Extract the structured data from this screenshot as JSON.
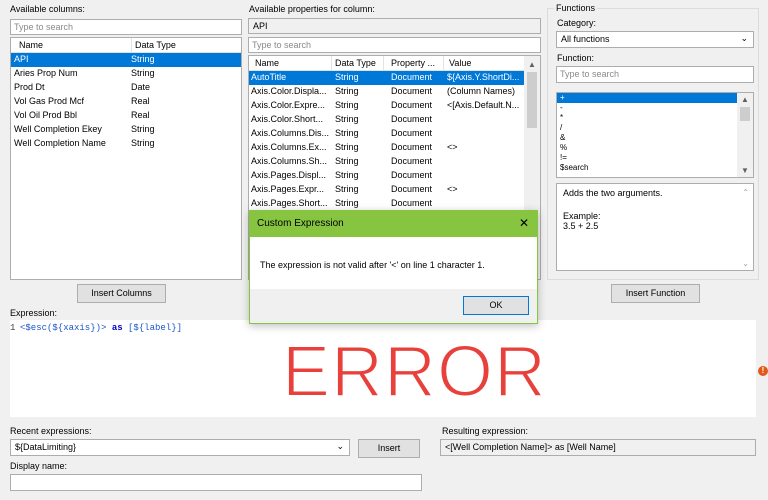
{
  "available_columns": {
    "label": "Available columns:",
    "search_placeholder": "Type to search",
    "headers": {
      "name": "Name",
      "type": "Data Type"
    },
    "rows": [
      {
        "name": "API",
        "type": "String"
      },
      {
        "name": "Aries Prop Num",
        "type": "String"
      },
      {
        "name": "Prod Dt",
        "type": "Date"
      },
      {
        "name": "Vol Gas Prod Mcf",
        "type": "Real"
      },
      {
        "name": "Vol Oil Prod Bbl",
        "type": "Real"
      },
      {
        "name": "Well Completion Ekey",
        "type": "String"
      },
      {
        "name": "Well Completion Name",
        "type": "String"
      }
    ],
    "insert_button": "Insert Columns"
  },
  "properties": {
    "label": "Available properties for column:",
    "column_value": "API",
    "search_placeholder": "Type to search",
    "headers": {
      "name": "Name",
      "type": "Data Type",
      "property": "Property ...",
      "value": "Value"
    },
    "rows": [
      {
        "name": "AutoTitle",
        "type": "String",
        "property": "Document",
        "value": "${Axis.Y.ShortDi..."
      },
      {
        "name": "Axis.Color.Displa...",
        "type": "String",
        "property": "Document",
        "value": "(Column Names)"
      },
      {
        "name": "Axis.Color.Expre...",
        "type": "String",
        "property": "Document",
        "value": "<[Axis.Default.N..."
      },
      {
        "name": "Axis.Color.Short...",
        "type": "String",
        "property": "Document",
        "value": ""
      },
      {
        "name": "Axis.Columns.Dis...",
        "type": "String",
        "property": "Document",
        "value": ""
      },
      {
        "name": "Axis.Columns.Ex...",
        "type": "String",
        "property": "Document",
        "value": "<>"
      },
      {
        "name": "Axis.Columns.Sh...",
        "type": "String",
        "property": "Document",
        "value": ""
      },
      {
        "name": "Axis.Pages.Displ...",
        "type": "String",
        "property": "Document",
        "value": ""
      },
      {
        "name": "Axis.Pages.Expr...",
        "type": "String",
        "property": "Document",
        "value": "<>"
      },
      {
        "name": "Axis.Pages.Short...",
        "type": "String",
        "property": "Document",
        "value": ""
      }
    ]
  },
  "functions": {
    "group_label": "Functions",
    "category_label": "Category:",
    "category_value": "All functions",
    "function_label": "Function:",
    "search_placeholder": "Type to search",
    "items": [
      "+",
      "-",
      "*",
      "/",
      "&",
      "%",
      "!=",
      "$search"
    ],
    "description": "Adds the two arguments.",
    "example_label": "Example:",
    "example_value": "3.5 + 2.5",
    "insert_button": "Insert Function"
  },
  "dialog": {
    "title": "Custom Expression",
    "close_glyph": "✕",
    "message": "The expression is not valid after '<' on line 1 character 1.",
    "ok_button": "OK"
  },
  "expression": {
    "label": "Expression:",
    "line_number": "1",
    "tokens": {
      "t1": "<$esc(${xaxis})>",
      "t2": " as ",
      "t3": "[${label}]"
    },
    "error_overlay": "ERROR",
    "error_icon": "!"
  },
  "recent": {
    "label": "Recent expressions:",
    "value": "${DataLimiting}",
    "insert_button": "Insert"
  },
  "resulting": {
    "label": "Resulting expression:",
    "value": "<[Well Completion Name]> as [Well Name]"
  },
  "display_name": {
    "label": "Display name:",
    "value": ""
  },
  "colors": {
    "selection": "#0078d7",
    "dialog_title_bar": "#87c440",
    "error_overlay": "#e8413c"
  }
}
